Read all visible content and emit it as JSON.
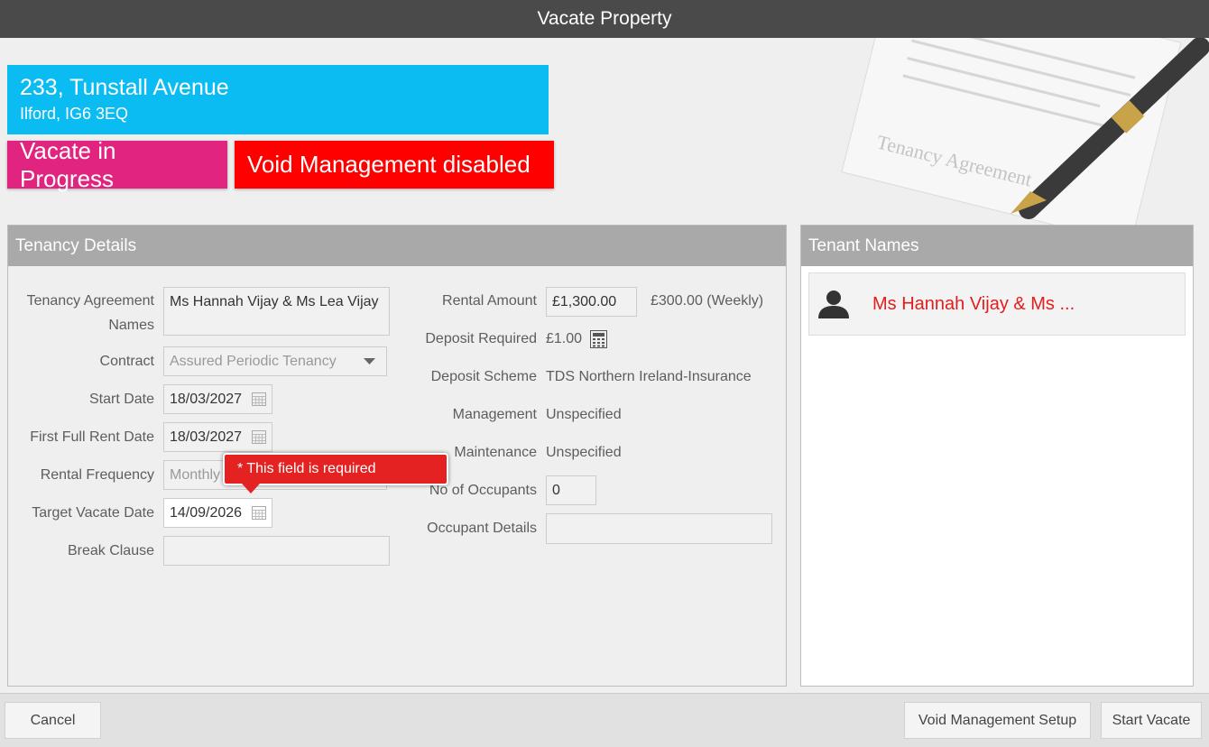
{
  "title": "Vacate Property",
  "property": {
    "address_line1": "233, Tunstall Avenue",
    "address_line2": "Ilford, IG6 3EQ"
  },
  "badges": {
    "status": "Vacate in Progress",
    "void": "Void Management disabled"
  },
  "background_art_text": "Tenancy Agreement",
  "tenancy": {
    "header": "Tenancy Details",
    "agreement_names_label_1": "Tenancy Agreement",
    "agreement_names_label_2": "Names",
    "agreement_names": "Ms Hannah Vijay & Ms Lea Vijay",
    "contract_label": "Contract",
    "contract_value": "Assured Periodic Tenancy",
    "start_date_label": "Start Date",
    "start_date": "18/03/2027",
    "first_full_rent_label": "First Full Rent Date",
    "first_full_rent_date": "18/03/2027",
    "rental_frequency_label": "Rental Frequency",
    "rental_frequency": "Monthly",
    "target_vacate_label": "Target Vacate Date",
    "target_vacate_date": "14/09/2026",
    "break_clause_label": "Break Clause",
    "break_clause": "",
    "rental_amount_label": "Rental Amount",
    "rental_amount": "£1,300.00",
    "rental_weekly": "£300.00 (Weekly)",
    "deposit_required_label": "Deposit Required",
    "deposit_required": "£1.00",
    "deposit_scheme_label": "Deposit Scheme",
    "deposit_scheme": "TDS Northern Ireland-Insurance",
    "management_label": "Management",
    "management": "Unspecified",
    "maintenance_label": "Maintenance",
    "maintenance": "Unspecified",
    "occupants_label": "No of Occupants",
    "occupants": "0",
    "occupant_details_label": "Occupant Details",
    "occupant_details": ""
  },
  "validation": {
    "message": "* This field is required"
  },
  "tenants": {
    "header": "Tenant Names",
    "items": [
      {
        "name": "Ms Hannah Vijay & Ms ..."
      }
    ]
  },
  "footer": {
    "cancel": "Cancel",
    "void_setup": "Void Management Setup",
    "start_vacate": "Start Vacate"
  },
  "colors": {
    "address_bg": "#0bbcf3",
    "status_bg": "#e0247f",
    "void_bg": "#ff0000",
    "error": "#e52222"
  }
}
